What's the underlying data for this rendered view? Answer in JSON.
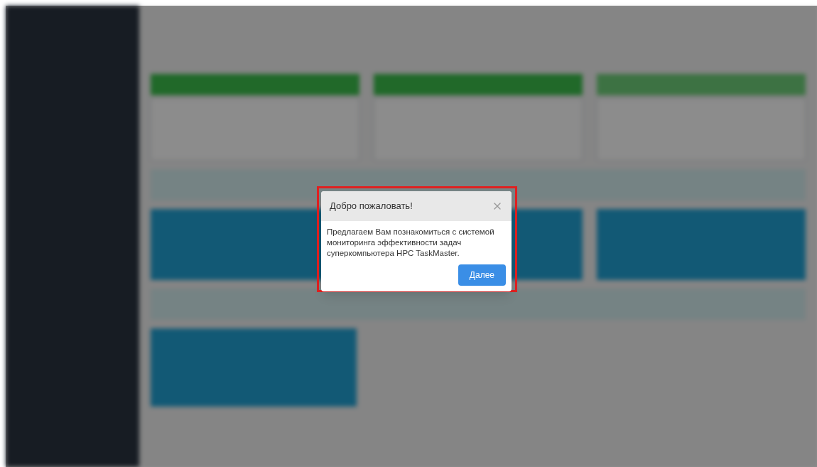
{
  "dialog": {
    "title": "Добро пожаловать!",
    "message": "Предлагаем Вам познакомиться с системой мониторинга эффективности задач суперкомпьютера HPC TaskMaster.",
    "button": "Далее",
    "highlighted": true
  }
}
